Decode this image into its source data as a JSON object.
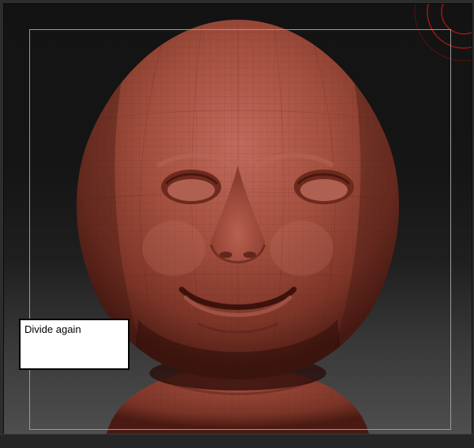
{
  "viewport": {
    "background_top": "#131313",
    "background_bottom": "#4e4e4e",
    "model_color": "#a24e42",
    "floor_frame_color": "#9a9a9a",
    "gizmo_color": "#b01818"
  },
  "annotation": {
    "text": "Divide again"
  },
  "icons": {
    "gizmo": "rotation-gizmo-icon"
  }
}
